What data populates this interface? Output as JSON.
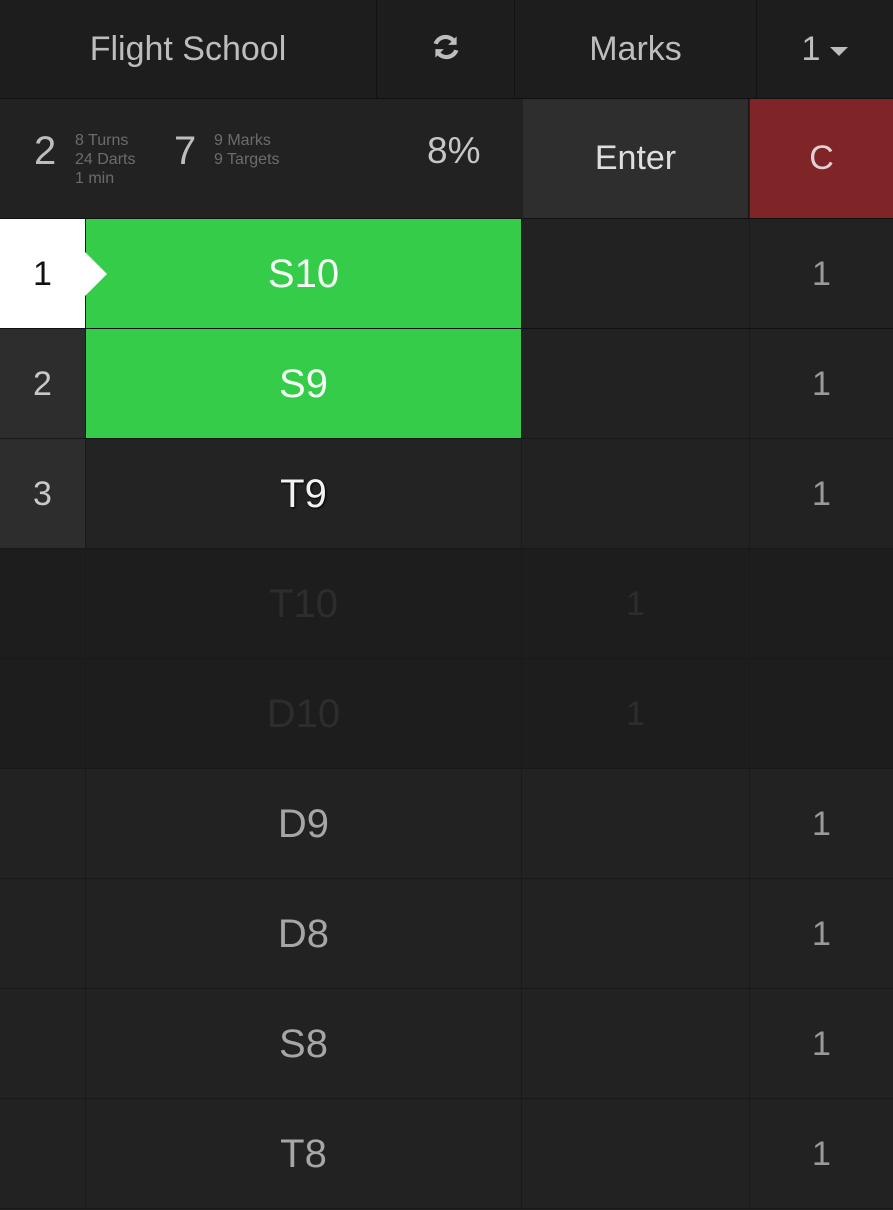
{
  "header": {
    "title": "Flight School",
    "refresh_icon": "refresh-icon",
    "mode": "Marks",
    "player": "1"
  },
  "stats": {
    "turns_count": "2",
    "turns": "8 Turns",
    "darts": "24 Darts",
    "time": "1 min",
    "marks_count": "7",
    "marks": "9 Marks",
    "targets": "9 Targets",
    "percent": "8%"
  },
  "actions": {
    "enter": "Enter",
    "clear": "C"
  },
  "colors": {
    "hit_green": "#35cc4a",
    "clear_red": "#7f2528",
    "background": "#222222"
  },
  "rows": [
    {
      "num": "1",
      "target": "S10",
      "mid": "",
      "right": "1"
    },
    {
      "num": "2",
      "target": "S9",
      "mid": "",
      "right": "1"
    },
    {
      "num": "3",
      "target": "T9",
      "mid": "",
      "right": "1"
    },
    {
      "num": "",
      "target": "T10",
      "mid": "1",
      "right": ""
    },
    {
      "num": "",
      "target": "D10",
      "mid": "1",
      "right": ""
    },
    {
      "num": "",
      "target": "D9",
      "mid": "",
      "right": "1"
    },
    {
      "num": "",
      "target": "D8",
      "mid": "",
      "right": "1"
    },
    {
      "num": "",
      "target": "S8",
      "mid": "",
      "right": "1"
    },
    {
      "num": "",
      "target": "T8",
      "mid": "",
      "right": "1"
    }
  ]
}
